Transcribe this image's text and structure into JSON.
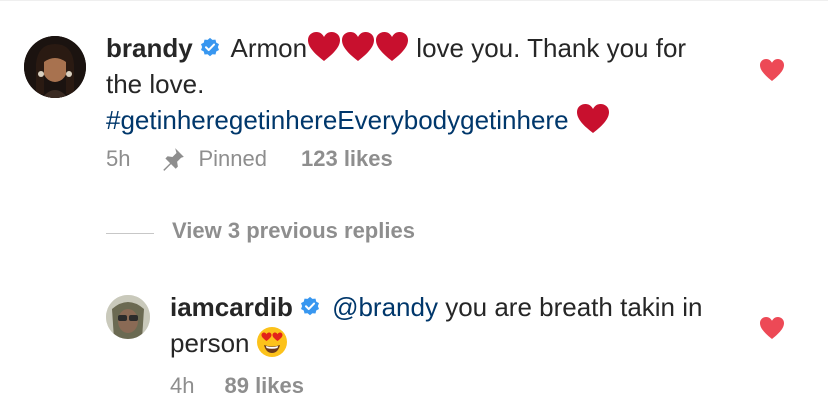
{
  "comment": {
    "username": "brandy",
    "verified": true,
    "text_before_hearts": "Armon",
    "text_after_hearts": "love you. Thank you for the love.",
    "hashtag": "#getinheregetinhereEverybodygetinhere",
    "time": "5h",
    "pinned_label": "Pinned",
    "likes": "123 likes",
    "liked": true
  },
  "replies_toggle": {
    "label": "View 3 previous replies"
  },
  "reply": {
    "username": "iamcardib",
    "verified": true,
    "mention": "@brandy",
    "text": "you are breath takin in person",
    "emoji": "heart-eyes-emoji",
    "time": "4h",
    "likes": "89 likes",
    "liked": true
  },
  "colors": {
    "heart": "#ed4956",
    "inline_heart": "#c8102e",
    "link": "#00376b",
    "verified": "#3897f0",
    "muted": "#8e8e8e"
  }
}
